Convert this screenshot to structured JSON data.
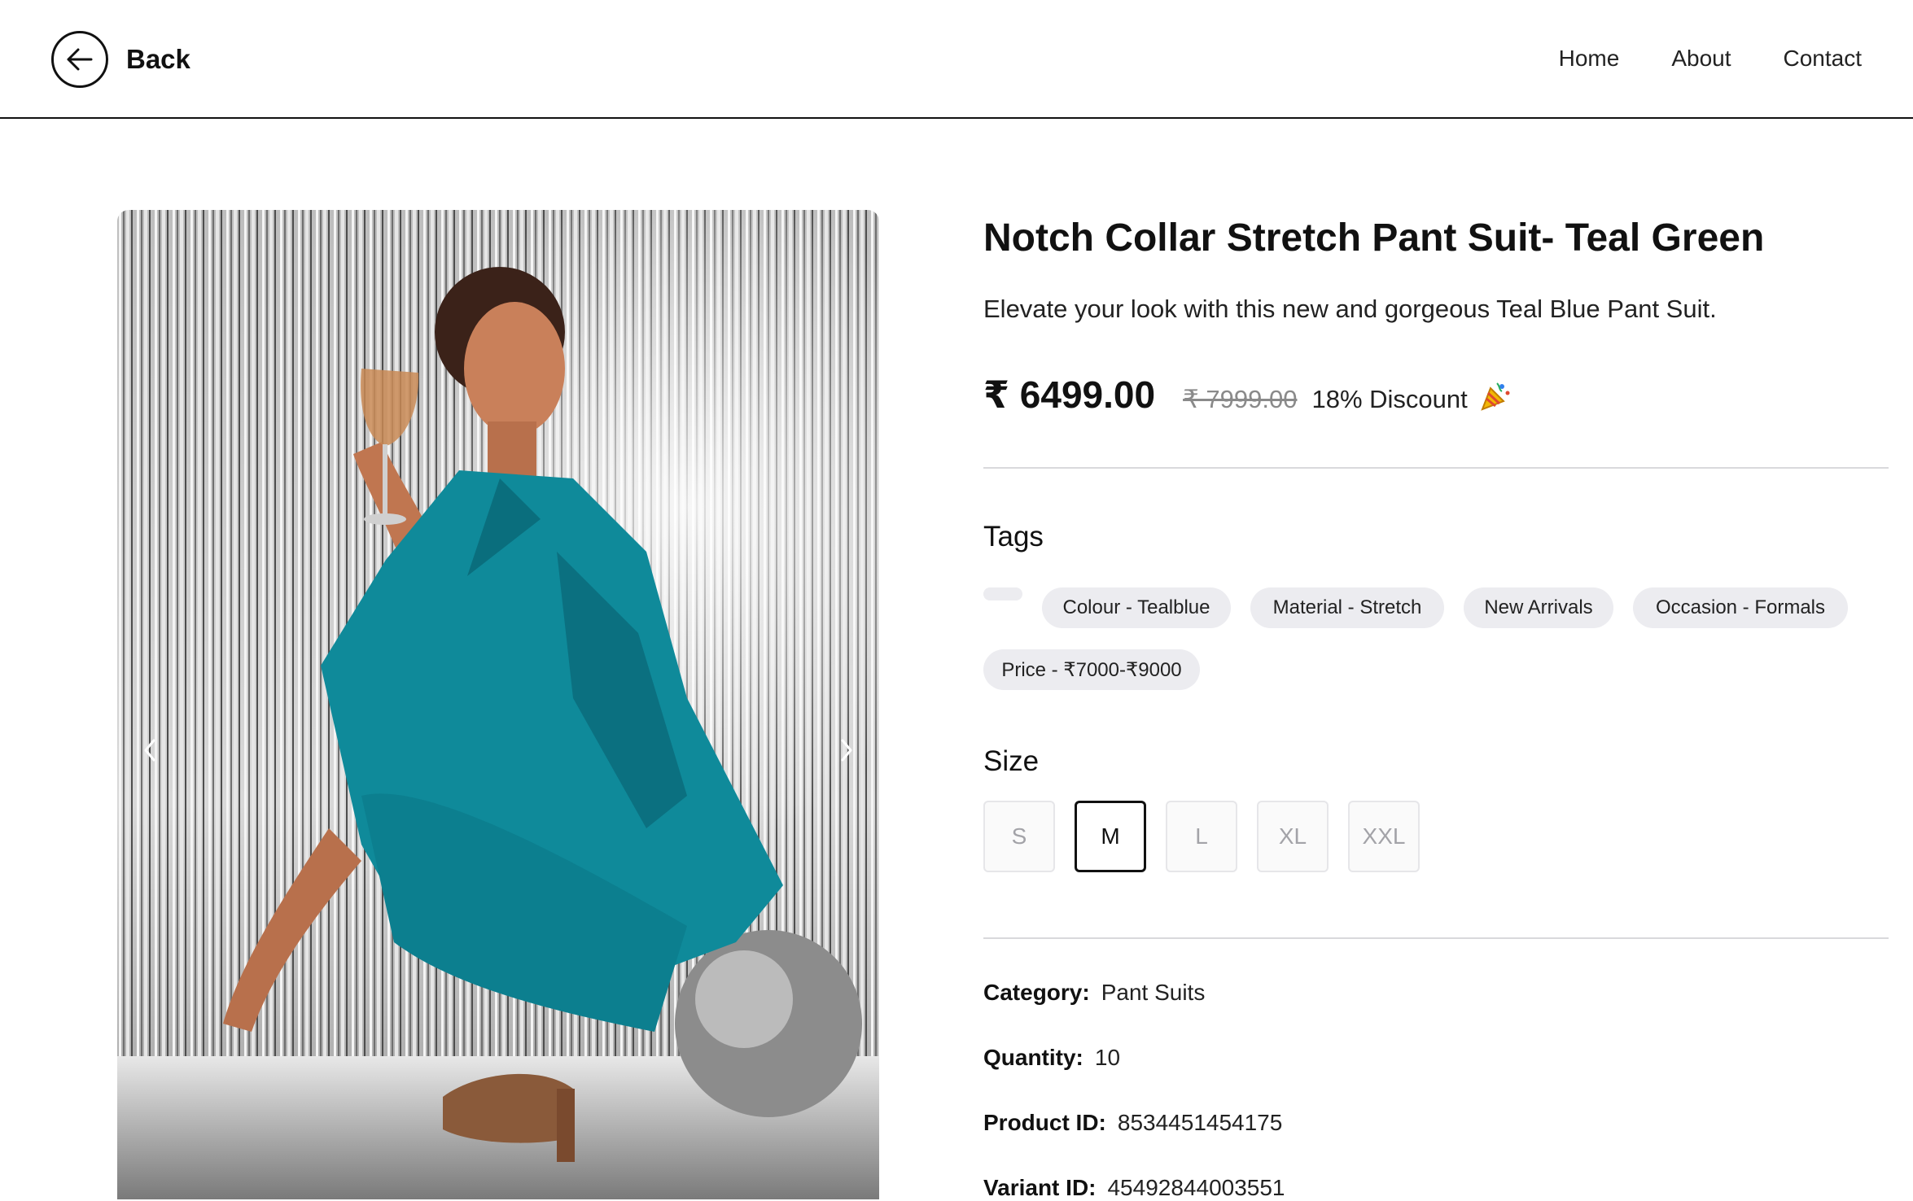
{
  "header": {
    "back_label": "Back",
    "nav": [
      "Home",
      "About",
      "Contact"
    ]
  },
  "product": {
    "title": "Notch Collar Stretch Pant Suit- Teal Green",
    "description": "Elevate your look with this new and gorgeous Teal Blue Pant Suit.",
    "price": "₹ 6499.00",
    "original_price": "₹ 7999.00",
    "discount": "18% Discount",
    "tags_label": "Tags",
    "tags": [
      "Colour - Tealblue",
      "Material - Stretch",
      "New Arrivals",
      "Occasion - Formals",
      "Price - ₹7000-₹9000"
    ],
    "size_label": "Size",
    "sizes": [
      "S",
      "M",
      "L",
      "XL",
      "XXL"
    ],
    "selected_size": "M",
    "meta": {
      "category_label": "Category:",
      "category": "Pant Suits",
      "quantity_label": "Quantity:",
      "quantity": "10",
      "product_id_label": "Product ID:",
      "product_id": "8534451454175",
      "variant_id_label": "Variant ID:",
      "variant_id": "45492844003551"
    }
  },
  "icons": {
    "back": "arrow-left-icon",
    "prev": "chevron-left-icon",
    "next": "chevron-right-icon",
    "discount": "party-popper-icon"
  },
  "colors": {
    "suit": "#0f8a9a",
    "tag_bg": "#ececf0",
    "divider": "#d9d9dc"
  }
}
